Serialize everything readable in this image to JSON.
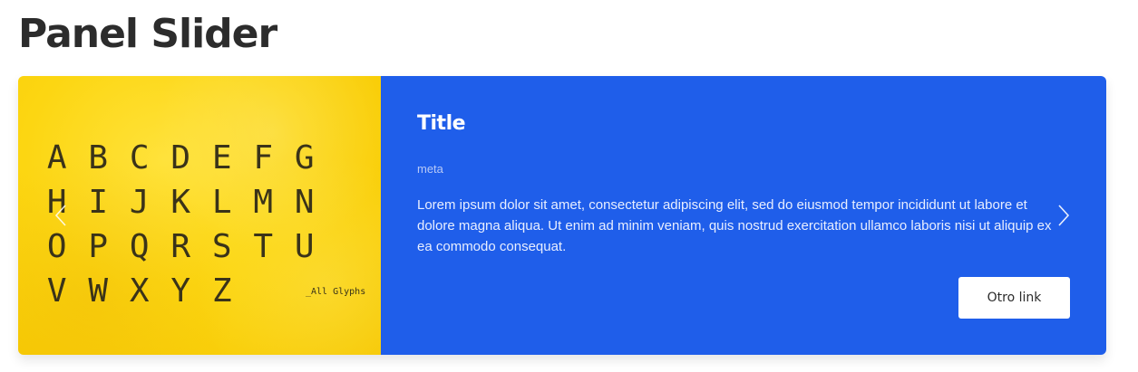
{
  "page": {
    "title": "Panel Slider"
  },
  "slide": {
    "glyphs": [
      "A",
      "B",
      "C",
      "D",
      "E",
      "F",
      "G",
      "H",
      "I",
      "J",
      "K",
      "L",
      "M",
      "N",
      "O",
      "P",
      "Q",
      "R",
      "S",
      "T",
      "U",
      "V",
      "W",
      "X",
      "Y",
      "Z"
    ],
    "glyph_caption": "_All Glyphs",
    "title": "Title",
    "meta": "meta",
    "body": "Lorem ipsum dolor sit amet, consectetur adipiscing elit, sed do eiusmod tempor incididunt ut labore et dolore magna aliqua. Ut enim ad minim veniam, quis nostrud exercitation ullamco laboris nisi ut aliquip ex ea commodo consequat.",
    "button_label": "Otro link"
  },
  "nav": {
    "prev_icon": "chevron-left-icon",
    "next_icon": "chevron-right-icon"
  },
  "colors": {
    "panel_blue": "#1f5eea",
    "image_yellow": "#fcd612",
    "title_dark": "#2c2c2c",
    "button_bg": "#ffffff"
  }
}
